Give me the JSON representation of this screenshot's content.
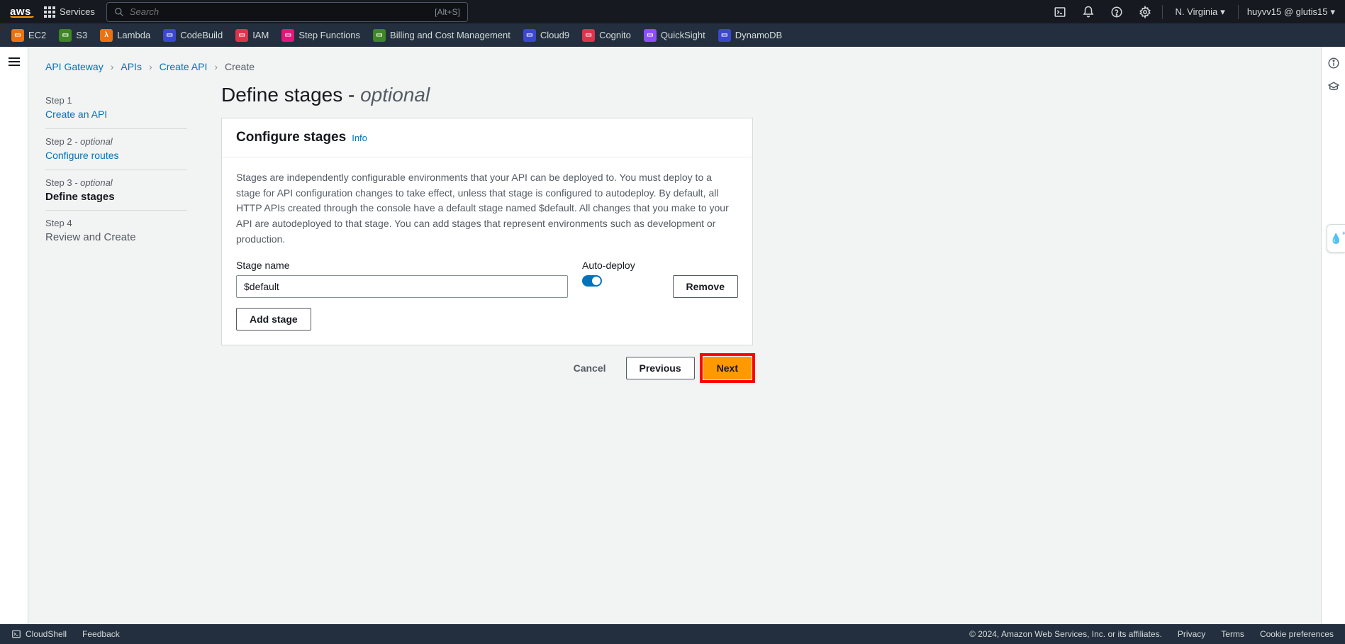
{
  "topnav": {
    "logo": "aws",
    "services_label": "Services",
    "search_placeholder": "Search",
    "search_hint": "[Alt+S]",
    "region": "N. Virginia",
    "account": "huyvv15 @ glutis15"
  },
  "svcbar": {
    "items": [
      {
        "label": "EC2",
        "color": "#ec7211"
      },
      {
        "label": "S3",
        "color": "#3f8624"
      },
      {
        "label": "Lambda",
        "color": "#ec7211"
      },
      {
        "label": "CodeBuild",
        "color": "#3b48cc"
      },
      {
        "label": "IAM",
        "color": "#dd344c"
      },
      {
        "label": "Step Functions",
        "color": "#e7157b"
      },
      {
        "label": "Billing and Cost Management",
        "color": "#3f8624"
      },
      {
        "label": "Cloud9",
        "color": "#3b48cc"
      },
      {
        "label": "Cognito",
        "color": "#dd344c"
      },
      {
        "label": "QuickSight",
        "color": "#8c4fff"
      },
      {
        "label": "DynamoDB",
        "color": "#3b48cc"
      }
    ]
  },
  "breadcrumb": {
    "items": [
      "API Gateway",
      "APIs",
      "Create API"
    ],
    "current": "Create"
  },
  "steps": {
    "s1_label": "Step 1",
    "s1_link": "Create an API",
    "s2_label": "Step 2",
    "s2_opt": " - optional",
    "s2_link": "Configure routes",
    "s3_label": "Step 3",
    "s3_opt": " - optional",
    "s3_title": "Define stages",
    "s4_label": "Step 4",
    "s4_title": "Review and Create"
  },
  "page": {
    "title_main": "Define stages",
    "title_sep": " - ",
    "title_opt": "optional"
  },
  "panel": {
    "header": "Configure stages",
    "info": "Info",
    "description": "Stages are independently configurable environments that your API can be deployed to. You must deploy to a stage for API configuration changes to take effect, unless that stage is configured to autodeploy. By default, all HTTP APIs created through the console have a default stage named $default. All changes that you make to your API are autodeployed to that stage. You can add stages that represent environments such as development or production.",
    "stage_name_label": "Stage name",
    "auto_deploy_label": "Auto-deploy",
    "stage_value": "$default",
    "remove_label": "Remove",
    "add_label": "Add stage"
  },
  "nav": {
    "cancel": "Cancel",
    "previous": "Previous",
    "next": "Next"
  },
  "footer": {
    "cloudshell": "CloudShell",
    "feedback": "Feedback",
    "copyright": "© 2024, Amazon Web Services, Inc. or its affiliates.",
    "privacy": "Privacy",
    "terms": "Terms",
    "cookies": "Cookie preferences"
  }
}
